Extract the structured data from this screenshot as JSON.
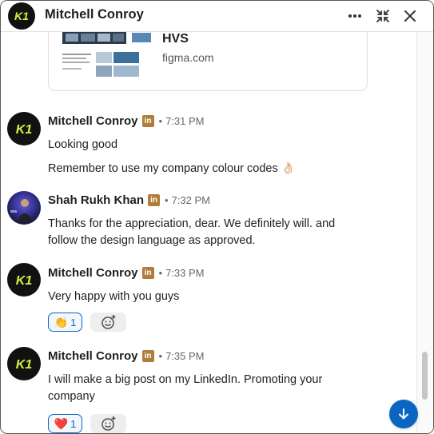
{
  "header": {
    "title": "Mitchell Conroy",
    "avatar_text": "K1"
  },
  "link_preview": {
    "title": "HVS",
    "domain": "figma.com"
  },
  "messages": [
    {
      "sender": "Mitchell Conroy",
      "badge": "in",
      "time": "7:31 PM",
      "lines": [
        "Looking good",
        "Remember to use my company colour codes 👌🏻"
      ]
    },
    {
      "sender": "Shah Rukh Khan",
      "badge": "in",
      "time": "7:32 PM",
      "lines": [
        "Thanks for the appreciation, dear. We definitely will. and follow the design language as approved."
      ]
    },
    {
      "sender": "Mitchell Conroy",
      "badge": "in",
      "time": "7:33 PM",
      "lines": [
        "Very happy with you guys"
      ],
      "reaction": {
        "emoji": "👏",
        "count": "1"
      }
    },
    {
      "sender": "Mitchell Conroy",
      "badge": "in",
      "time": "7:35 PM",
      "lines": [
        "I will make a big post on my LinkedIn. Promoting your company"
      ],
      "reaction": {
        "emoji": "❤️",
        "count": "1"
      }
    }
  ],
  "separator": "•",
  "colors": {
    "accent": "#0a66c2",
    "linkedin_badge": "#b07e3a",
    "avatar_bg": "#111111",
    "avatar_mark": "#d6f03c"
  },
  "icons": [
    "more-icon",
    "minimize-icon",
    "close-icon",
    "add-reaction-icon",
    "scroll-down-icon"
  ]
}
